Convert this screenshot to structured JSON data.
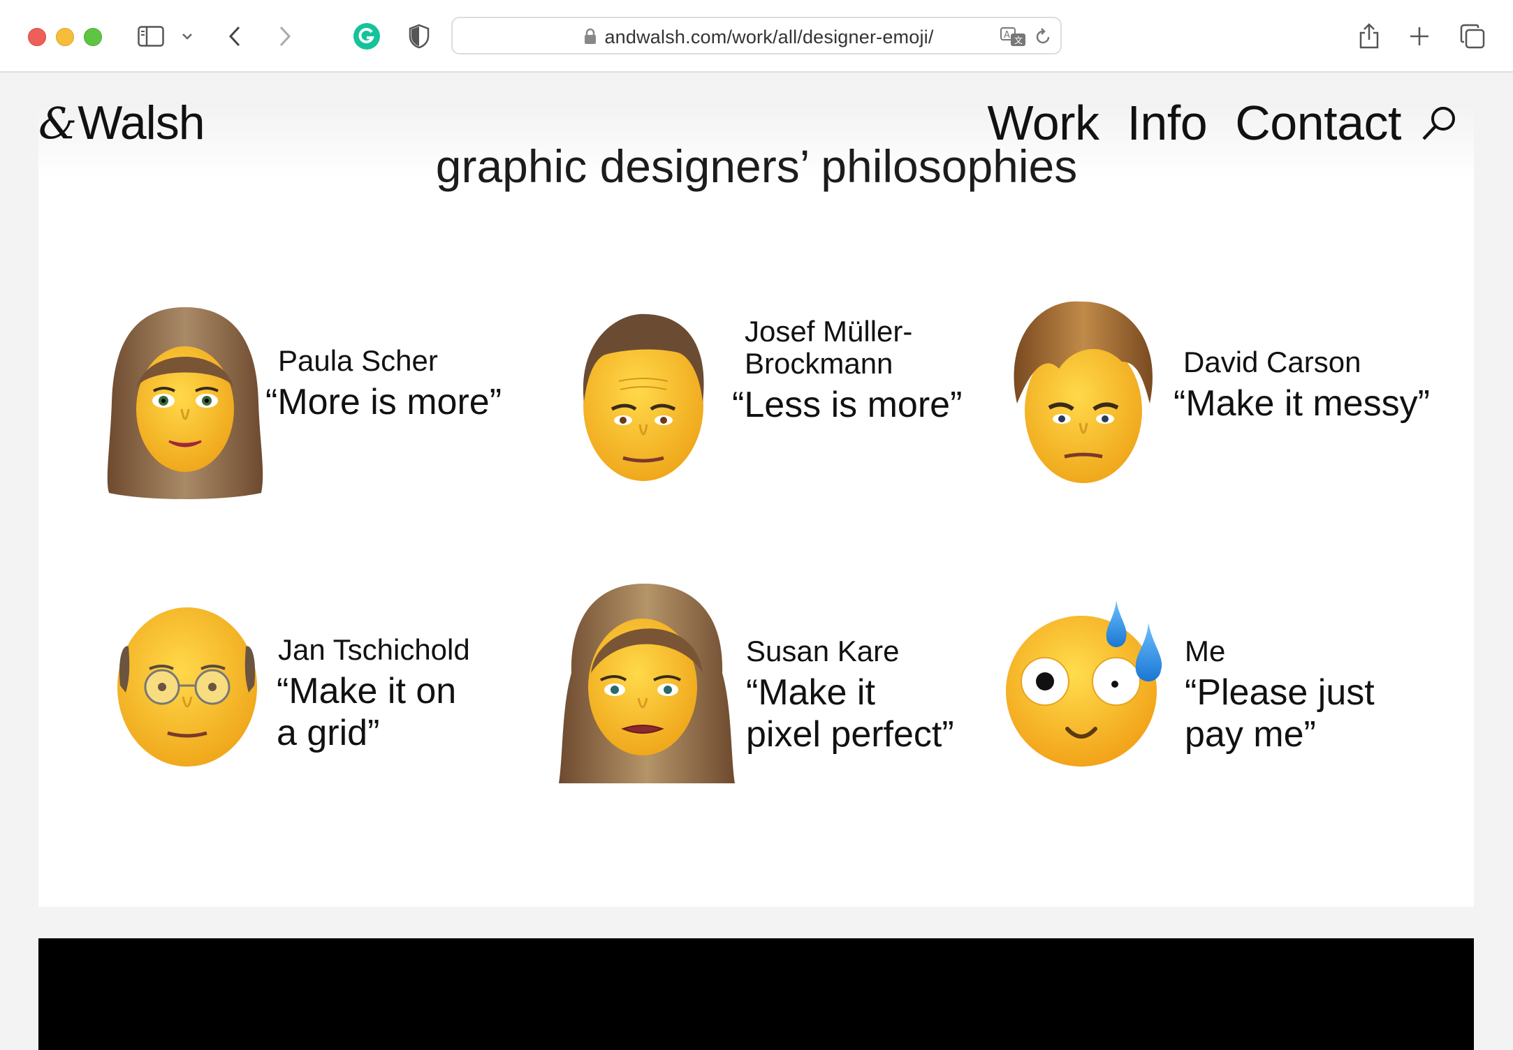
{
  "browser": {
    "url": "andwalsh.com/work/all/designer-emoji/",
    "icons": [
      "sidebar-icon",
      "chevron-down-icon",
      "back-icon",
      "forward-icon",
      "grammarly-icon",
      "shield-icon",
      "lock-icon",
      "translate-icon",
      "reload-icon",
      "share-icon",
      "new-tab-icon",
      "tabs-overview-icon"
    ]
  },
  "site": {
    "logo_amp": "&",
    "logo_text": "Walsh",
    "nav": [
      "Work",
      "Info",
      "Contact"
    ]
  },
  "content": {
    "title": "graphic designers’ philosophies",
    "designers": [
      {
        "name": "Paula Scher",
        "quote": "“More is more”"
      },
      {
        "name": "Josef Müller-Brockmann",
        "name_line1": "Josef Müller-",
        "name_line2": "Brockmann",
        "quote": "“Less is more”"
      },
      {
        "name": "David Carson",
        "quote": "“Make it messy”"
      },
      {
        "name": "Jan Tschichold",
        "quote": "“Make it on a grid”",
        "quote_line1": "“Make it on",
        "quote_line2": "a grid”"
      },
      {
        "name": "Susan Kare",
        "quote": "“Make it pixel perfect”",
        "quote_line1": "“Make it",
        "quote_line2": "pixel perfect”"
      },
      {
        "name": "Me",
        "quote": "“Please just pay me”",
        "quote_line1": "“Please just",
        "quote_line2": "pay me”"
      }
    ]
  },
  "colors": {
    "emoji_yellow": "#f6c52a",
    "hair_brown": "#8a6a48",
    "sweat_blue": "#2e8fe0"
  }
}
